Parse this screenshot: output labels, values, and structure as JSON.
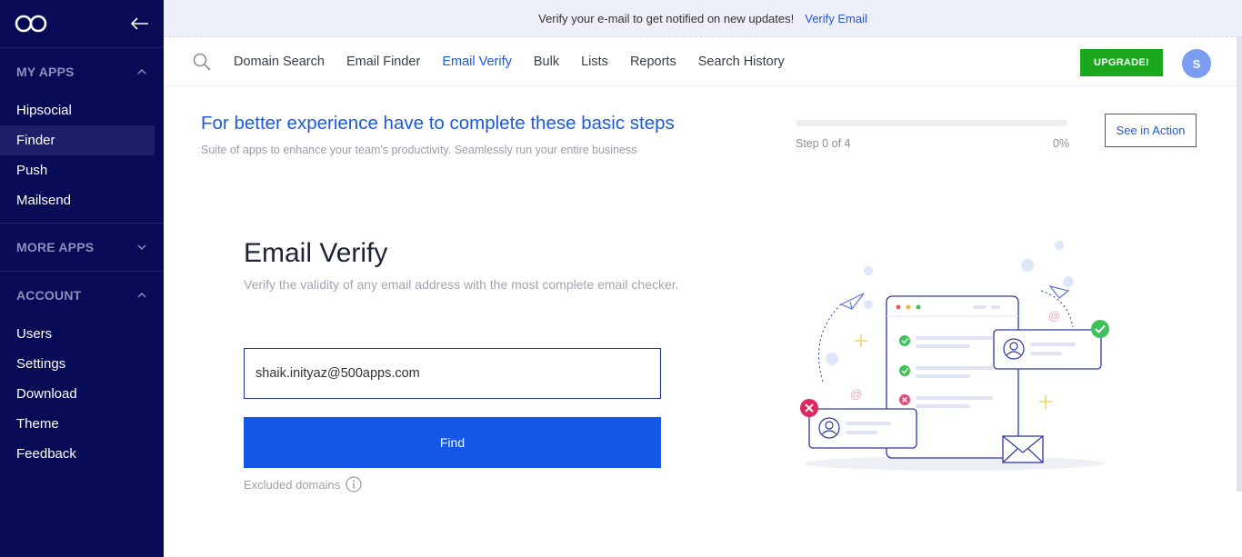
{
  "sidebar": {
    "sections": {
      "my_apps": "MY APPS",
      "more_apps": "MORE APPS",
      "account": "ACCOUNT"
    },
    "my_apps_items": [
      {
        "label": "Hipsocial"
      },
      {
        "label": "Finder"
      },
      {
        "label": "Push"
      },
      {
        "label": "Mailsend"
      }
    ],
    "account_items": [
      {
        "label": "Users"
      },
      {
        "label": "Settings"
      },
      {
        "label": "Download"
      },
      {
        "label": "Theme"
      },
      {
        "label": "Feedback"
      }
    ],
    "active_item": "Finder"
  },
  "banner": {
    "text": "Verify your e-mail to get notified on new updates!",
    "link": "Verify Email"
  },
  "topnav": {
    "items": [
      {
        "label": "Domain Search"
      },
      {
        "label": "Email Finder"
      },
      {
        "label": "Email Verify"
      },
      {
        "label": "Bulk"
      },
      {
        "label": "Lists"
      },
      {
        "label": "Reports"
      },
      {
        "label": "Search History"
      }
    ],
    "active": "Email Verify",
    "upgrade_label": "UPGRADE!",
    "avatar_initial": "S"
  },
  "onboarding": {
    "title": "For better experience have to complete these basic steps",
    "subtitle": "Suite of apps to enhance your team's productivity. Seamlessly run your entire business",
    "step_text": "Step 0 of 4",
    "percent_text": "0%",
    "progress": 0,
    "action_label": "See in Action"
  },
  "verify": {
    "title": "Email Verify",
    "subtitle": "Verify the validity of any email address with the most complete email checker.",
    "input_value": "shaik.inityaz@500apps.com",
    "button_label": "Find",
    "excluded_label": "Excluded domains"
  },
  "colors": {
    "sidebar_bg": "#070b55",
    "accent": "#1557e6",
    "upgrade": "#1ba81e",
    "avatar": "#7b9df2"
  }
}
